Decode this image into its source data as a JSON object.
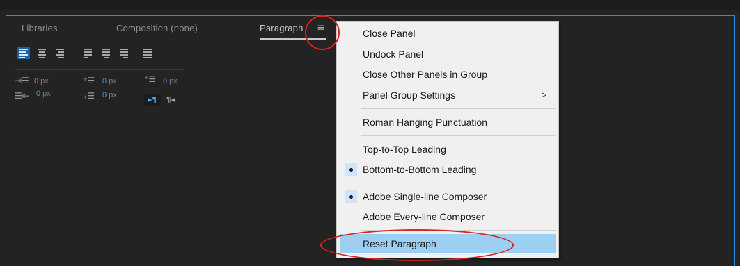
{
  "tabs": {
    "libraries": "Libraries",
    "composition": "Composition (none)",
    "paragraph": "Paragraph",
    "menu_icon": "hamburger-menu-icon"
  },
  "paragraph_panel": {
    "alignment_buttons": [
      "align-left-icon",
      "align-center-icon",
      "align-right-icon",
      "justify-last-left-icon",
      "justify-last-center-icon",
      "justify-last-right-icon",
      "justify-all-icon"
    ],
    "fields": {
      "indent_left": {
        "value": "0",
        "unit": "px"
      },
      "space_before": {
        "value": "0",
        "unit": "px"
      },
      "first_line": {
        "value": "0",
        "unit": "px"
      },
      "indent_right": {
        "value": "0",
        "unit": "px"
      },
      "space_after": {
        "value": "0",
        "unit": "px"
      }
    },
    "direction": {
      "ltr": "▸¶",
      "rtl": "¶◂"
    }
  },
  "menu": {
    "items": [
      {
        "label": "Close Panel"
      },
      {
        "label": "Undock Panel"
      },
      {
        "label": "Close Other Panels in Group"
      },
      {
        "label": "Panel Group Settings",
        "submenu_arrow": ">"
      },
      {
        "label": "Roman Hanging Punctuation"
      },
      {
        "label": "Top-to-Top Leading"
      },
      {
        "label": "Bottom-to-Bottom Leading",
        "checked": true
      },
      {
        "label": "Adobe Single-line Composer",
        "checked": true
      },
      {
        "label": "Adobe Every-line Composer"
      },
      {
        "label": "Reset Paragraph",
        "highlighted": true
      }
    ]
  },
  "annotation_color": "#d9241e",
  "accent_color": "#2d8ceb"
}
